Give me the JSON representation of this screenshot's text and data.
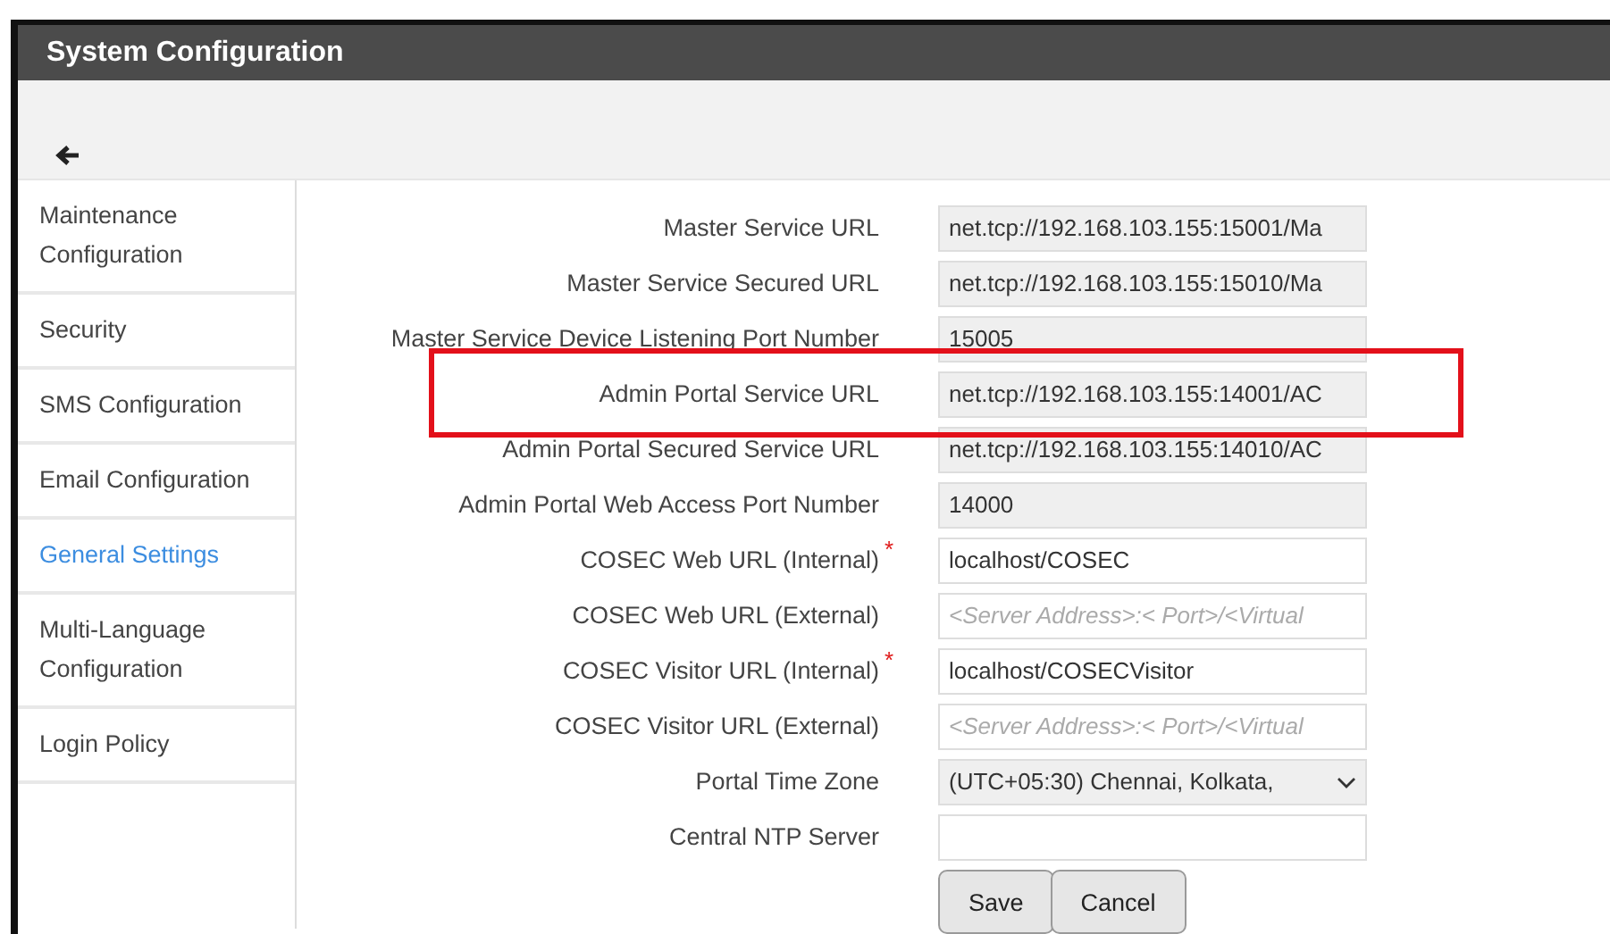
{
  "window": {
    "title": "System Configuration"
  },
  "sidebar": {
    "items": [
      {
        "label": "Maintenance Configuration",
        "selected": false
      },
      {
        "label": "Security",
        "selected": false
      },
      {
        "label": "SMS Configuration",
        "selected": false
      },
      {
        "label": "Email Configuration",
        "selected": false
      },
      {
        "label": "General Settings",
        "selected": true
      },
      {
        "label": "Multi-Language Configuration",
        "selected": false
      },
      {
        "label": "Login Policy",
        "selected": false
      }
    ]
  },
  "form": {
    "fields": [
      {
        "label": "Master Service URL",
        "kind": "readonly",
        "value": "net.tcp://192.168.103.155:15001/Ma"
      },
      {
        "label": "Master Service Secured URL",
        "kind": "readonly",
        "value": "net.tcp://192.168.103.155:15010/Ma"
      },
      {
        "label": "Master Service Device Listening Port Number",
        "kind": "readonly",
        "value": "15005"
      },
      {
        "label": "Admin Portal Service URL",
        "kind": "readonly",
        "value": "net.tcp://192.168.103.155:14001/AC"
      },
      {
        "label": "Admin Portal Secured Service URL",
        "kind": "readonly",
        "value": "net.tcp://192.168.103.155:14010/AC"
      },
      {
        "label": "Admin Portal Web Access Port Number",
        "kind": "readonly",
        "value": "14000"
      },
      {
        "label": "COSEC Web URL (Internal)",
        "kind": "text",
        "required_mark": "*",
        "value": "localhost/COSEC"
      },
      {
        "label": "COSEC Web URL (External)",
        "kind": "text",
        "placeholder": "<Server Address>:< Port>/<Virtual"
      },
      {
        "label": "COSEC Visitor URL (Internal)",
        "kind": "text",
        "required_mark": "*",
        "value": "localhost/COSECVisitor"
      },
      {
        "label": "COSEC Visitor URL (External)",
        "kind": "text",
        "placeholder": "<Server Address>:< Port>/<Virtual"
      },
      {
        "label": "Portal Time Zone",
        "kind": "select",
        "value": "(UTC+05:30) Chennai, Kolkata,"
      },
      {
        "label": "Central NTP Server",
        "kind": "text"
      }
    ],
    "buttons": [
      "Save",
      "Cancel"
    ]
  }
}
